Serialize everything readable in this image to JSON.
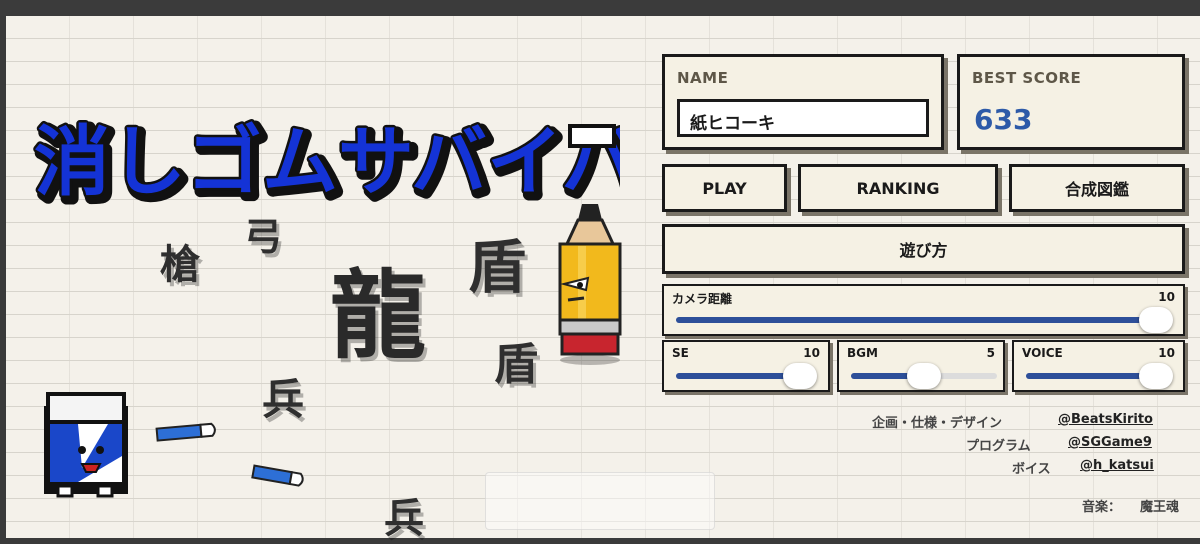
{
  "title": "消しゴムサバイバー",
  "background_kanji": {
    "yari": "槍",
    "yumi": "弓",
    "ryu": "龍",
    "tate1": "盾",
    "tate2": "盾",
    "hei1": "兵",
    "hei2": "兵"
  },
  "name_panel": {
    "label": "NAME",
    "value": "紙ヒコーキ"
  },
  "score_panel": {
    "label": "BEST SCORE",
    "value": "633"
  },
  "buttons": {
    "play": "PLAY",
    "ranking": "RANKING",
    "zukan": "合成図鑑",
    "howto": "遊び方"
  },
  "sliders": {
    "camera": {
      "label": "カメラ距離",
      "value": "10",
      "level": 1.0
    },
    "se": {
      "label": "SE",
      "value": "10",
      "level": 1.0
    },
    "bgm": {
      "label": "BGM",
      "value": "5",
      "level": 0.5
    },
    "voice": {
      "label": "VOICE",
      "value": "10",
      "level": 1.0
    }
  },
  "credits": {
    "planning_label": "企画・仕様・デザイン",
    "planning_name": "@BeatsKirito",
    "program_label": "プログラム",
    "program_name": "@SGGame9",
    "voice_label": "ボイス",
    "voice_name": "@h_katsui",
    "music_label": "音楽：",
    "music_name": "魔王魂"
  },
  "colors": {
    "accent": "#2d5aa8",
    "title_blue": "#1433d6",
    "slider_fill": "#2d4f99",
    "paper": "#f4f1ea"
  }
}
